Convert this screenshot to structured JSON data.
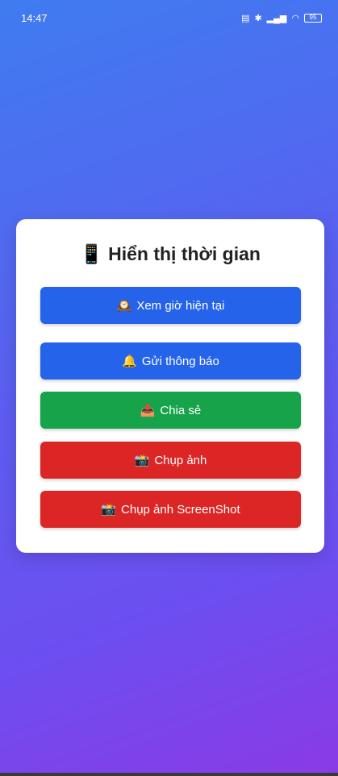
{
  "status_bar": {
    "time": "14:47",
    "icons": [
      "sim-icon",
      "bluetooth-icon",
      "signal-icon",
      "wifi-icon",
      "battery-icon"
    ],
    "battery_level": "95"
  },
  "card": {
    "title_icon": "📱",
    "title": "Hiển thị thời gian"
  },
  "buttons": [
    {
      "icon": "🕰️",
      "label": "Xem giờ hiện tại"
    },
    {
      "icon": "🔔",
      "label": "Gửi thông báo"
    },
    {
      "icon": "📤",
      "label": "Chia sẻ"
    },
    {
      "icon": "📸",
      "label": "Chụp ảnh"
    },
    {
      "icon": "📸",
      "label": "Chụp ảnh ScreenShot"
    }
  ],
  "colors": {
    "blue": "#2563eb",
    "green": "#16a34a",
    "red": "#dc2626"
  }
}
